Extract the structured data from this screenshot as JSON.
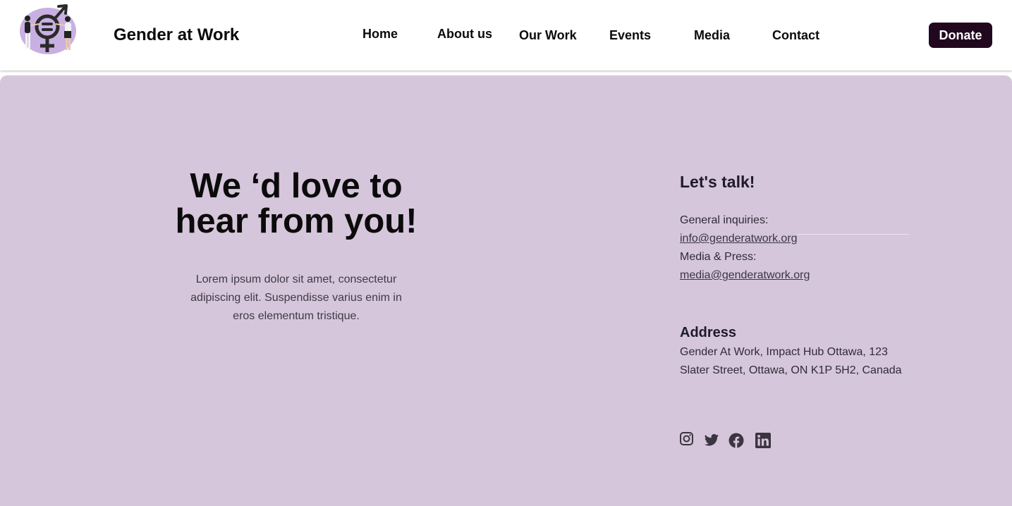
{
  "header": {
    "brand": "Gender at Work",
    "nav": [
      "Home",
      "About us",
      "Our Work",
      "Events",
      "Media",
      "Contact"
    ],
    "donate_label": "Donate"
  },
  "hero": {
    "headline": [
      "We ‘d love to",
      "hear from you!"
    ],
    "lead": [
      "Lorem ipsum dolor sit amet, consectetur",
      "adipiscing elit. Suspendisse varius enim in",
      "eros elementum tristique."
    ]
  },
  "contact": {
    "title": "Let's talk!",
    "general_label": "General inquiries:",
    "general_email": "info@genderatwork.org",
    "media_label": "Media & Press:",
    "media_email": "media@genderatwork.org",
    "address_title": "Address",
    "address_lines": [
      "Gender At Work, Impact Hub Ottawa, 123",
      "Slater Street, Ottawa, ON K1P 5H2, Canada"
    ]
  },
  "social_icons": [
    "instagram-icon",
    "twitter-icon",
    "facebook-icon",
    "linkedin-icon"
  ],
  "colors": {
    "hero_bg": "#d6c6db",
    "donate_bg": "#22081f",
    "text_dark": "#0b0b0b",
    "icon_gray": "#3a3540"
  }
}
